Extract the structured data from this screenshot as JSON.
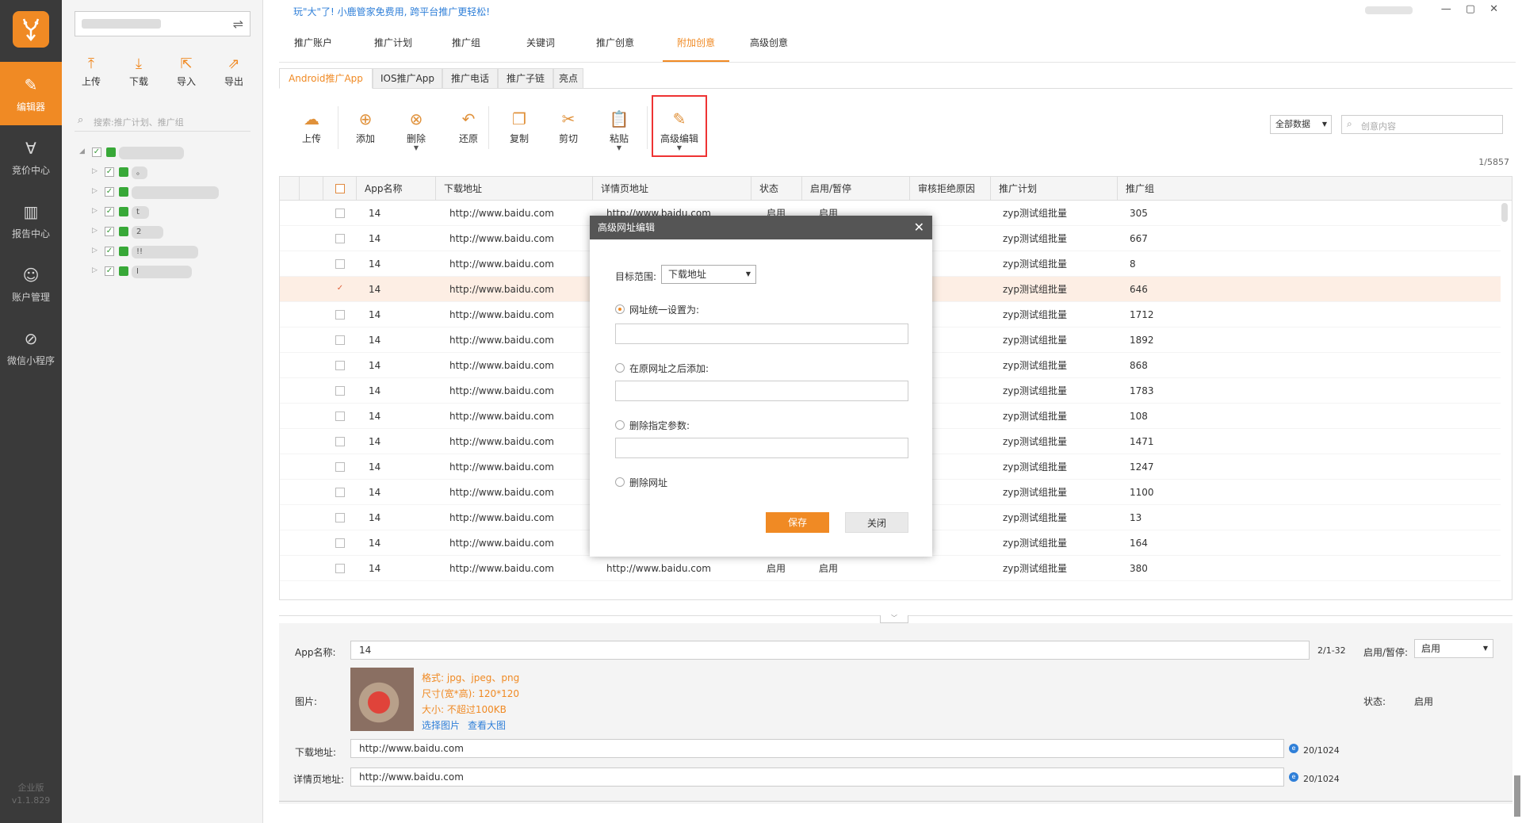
{
  "app": {
    "promo": "玩\"大\"了! 小鹿管家免费用, 跨平台推广更轻松!",
    "window_controls": [
      "—",
      "▢",
      "✕"
    ]
  },
  "rail": {
    "items": [
      {
        "label": "编辑器",
        "icon": "edit-icon",
        "glyph": "✎"
      },
      {
        "label": "竞价中心",
        "icon": "bid-icon",
        "glyph": "∀"
      },
      {
        "label": "报告中心",
        "icon": "report-icon",
        "glyph": "▥"
      },
      {
        "label": "账户管理",
        "icon": "user-icon",
        "glyph": "☺"
      },
      {
        "label": "微信小程序",
        "icon": "mini-program-icon",
        "glyph": "⊘"
      }
    ],
    "edition": "企业版",
    "version": "v1.1.829"
  },
  "tree_panel": {
    "swap_glyph": "⇌",
    "actions": [
      {
        "label": "上传",
        "glyph": "⤒"
      },
      {
        "label": "下载",
        "glyph": "⤓"
      },
      {
        "label": "导入",
        "glyph": "⇱"
      },
      {
        "label": "导出",
        "glyph": "⇗"
      }
    ],
    "search_placeholder": "搜索:推广计划、推广组",
    "check_glyph": "✓",
    "nodes": [
      {
        "expanded": true,
        "label": ""
      },
      {
        "expanded": false,
        "label": "。"
      },
      {
        "expanded": false,
        "label": ""
      },
      {
        "expanded": false,
        "label": "t"
      },
      {
        "expanded": false,
        "label": "2"
      },
      {
        "expanded": false,
        "label": "!!"
      },
      {
        "expanded": false,
        "label": "I"
      }
    ]
  },
  "top_tabs": [
    {
      "label": "推广账户",
      "active": false
    },
    {
      "label": "推广计划",
      "active": false
    },
    {
      "label": "推广组",
      "active": false
    },
    {
      "label": "关键词",
      "active": false
    },
    {
      "label": "推广创意",
      "active": false
    },
    {
      "label": "附加创意",
      "active": true
    },
    {
      "label": "高级创意",
      "active": false
    }
  ],
  "sub_tabs": [
    {
      "label": "Android推广App",
      "active": true
    },
    {
      "label": "IOS推广App",
      "active": false
    },
    {
      "label": "推广电话",
      "active": false
    },
    {
      "label": "推广子链",
      "active": false
    },
    {
      "label": "亮点",
      "active": false
    }
  ],
  "toolbar": [
    {
      "label": "上传",
      "glyph": "☁",
      "icon": "upload-cloud-icon",
      "caret": false
    },
    {
      "label": "添加",
      "glyph": "⊕",
      "icon": "add-icon",
      "caret": false
    },
    {
      "label": "删除",
      "glyph": "⊗",
      "icon": "delete-icon",
      "caret": true
    },
    {
      "label": "还原",
      "glyph": "↶",
      "icon": "undo-icon",
      "caret": false
    },
    {
      "label": "复制",
      "glyph": "❐",
      "icon": "copy-icon",
      "caret": false
    },
    {
      "label": "剪切",
      "glyph": "✂",
      "icon": "cut-icon",
      "caret": false
    },
    {
      "label": "粘贴",
      "glyph": "📋",
      "icon": "paste-icon",
      "caret": true
    },
    {
      "label": "高级编辑",
      "glyph": "✎",
      "icon": "advanced-edit-icon",
      "caret": true
    }
  ],
  "filter": {
    "selected": "全部数据",
    "search_placeholder": "创意内容",
    "page_count": "1/5857"
  },
  "table": {
    "columns": [
      "App名称",
      "下载地址",
      "详情页地址",
      "状态",
      "启用/暂停",
      "审核拒绝原因",
      "推广计划",
      "推广组"
    ],
    "rows": [
      {
        "name": "14",
        "download": "http://www.baidu.com",
        "detail": "http://www.baidu.com",
        "status": "启用",
        "enable": "启用",
        "reason": "",
        "plan": "zyp测试组批量",
        "group": "305",
        "checked": false
      },
      {
        "name": "14",
        "download": "http://www.baidu.com",
        "detail": "",
        "status": "",
        "enable": "",
        "reason": "",
        "plan": "zyp测试组批量",
        "group": "667",
        "checked": false
      },
      {
        "name": "14",
        "download": "http://www.baidu.com",
        "detail": "",
        "status": "",
        "enable": "",
        "reason": "",
        "plan": "zyp测试组批量",
        "group": "8",
        "checked": false
      },
      {
        "name": "14",
        "download": "http://www.baidu.com",
        "detail": "",
        "status": "",
        "enable": "",
        "reason": "",
        "plan": "zyp测试组批量",
        "group": "646",
        "checked": true
      },
      {
        "name": "14",
        "download": "http://www.baidu.com",
        "detail": "",
        "status": "",
        "enable": "",
        "reason": "",
        "plan": "zyp测试组批量",
        "group": "1712",
        "checked": false
      },
      {
        "name": "14",
        "download": "http://www.baidu.com",
        "detail": "",
        "status": "",
        "enable": "",
        "reason": "",
        "plan": "zyp测试组批量",
        "group": "1892",
        "checked": false
      },
      {
        "name": "14",
        "download": "http://www.baidu.com",
        "detail": "",
        "status": "",
        "enable": "",
        "reason": "",
        "plan": "zyp测试组批量",
        "group": "868",
        "checked": false
      },
      {
        "name": "14",
        "download": "http://www.baidu.com",
        "detail": "",
        "status": "",
        "enable": "",
        "reason": "",
        "plan": "zyp测试组批量",
        "group": "1783",
        "checked": false
      },
      {
        "name": "14",
        "download": "http://www.baidu.com",
        "detail": "",
        "status": "",
        "enable": "",
        "reason": "",
        "plan": "zyp测试组批量",
        "group": "108",
        "checked": false
      },
      {
        "name": "14",
        "download": "http://www.baidu.com",
        "detail": "",
        "status": "",
        "enable": "",
        "reason": "",
        "plan": "zyp测试组批量",
        "group": "1471",
        "checked": false
      },
      {
        "name": "14",
        "download": "http://www.baidu.com",
        "detail": "",
        "status": "",
        "enable": "",
        "reason": "",
        "plan": "zyp测试组批量",
        "group": "1247",
        "checked": false
      },
      {
        "name": "14",
        "download": "http://www.baidu.com",
        "detail": "",
        "status": "",
        "enable": "",
        "reason": "",
        "plan": "zyp测试组批量",
        "group": "1100",
        "checked": false
      },
      {
        "name": "14",
        "download": "http://www.baidu.com",
        "detail": "",
        "status": "",
        "enable": "",
        "reason": "",
        "plan": "zyp测试组批量",
        "group": "13",
        "checked": false
      },
      {
        "name": "14",
        "download": "http://www.baidu.com",
        "detail": "",
        "status": "",
        "enable": "",
        "reason": "",
        "plan": "zyp测试组批量",
        "group": "164",
        "checked": false
      },
      {
        "name": "14",
        "download": "http://www.baidu.com",
        "detail": "http://www.baidu.com",
        "status": "启用",
        "enable": "启用",
        "reason": "",
        "plan": "zyp测试组批量",
        "group": "380",
        "checked": false
      }
    ]
  },
  "form": {
    "app_name_label": "App名称:",
    "app_name_value": "14",
    "app_name_count": "2/1-32",
    "enable_label": "启用/暂停:",
    "enable_value": "启用",
    "image_label": "图片:",
    "format_hint": "格式: jpg、jpeg、png",
    "size_hint": "尺寸(宽*高): 120*120",
    "filesize_hint": "大小: 不超过100KB",
    "choose_image": "选择图片",
    "view_large": "查看大图",
    "status_label": "状态:",
    "status_value": "启用",
    "download_label": "下载地址:",
    "download_value": "http://www.baidu.com",
    "download_count": "20/1024",
    "detail_label": "详情页地址:",
    "detail_value": "http://www.baidu.com",
    "detail_count": "20/1024",
    "ie_glyph": "e",
    "splitter_glyph": "﹀"
  },
  "dialog": {
    "title": "高级网址编辑",
    "close_glyph": "✕",
    "scope_label": "目标范围:",
    "scope_value": "下载地址",
    "opt_set": "网址统一设置为:",
    "opt_append": "在原网址之后添加:",
    "opt_remove_param": "删除指定参数:",
    "opt_delete": "删除网址",
    "save": "保存",
    "close": "关闭"
  },
  "colors": {
    "accent": "#f08a24",
    "rail": "#3a3a3a",
    "highlight_box": "#ee3333",
    "link": "#2f7fd8"
  }
}
